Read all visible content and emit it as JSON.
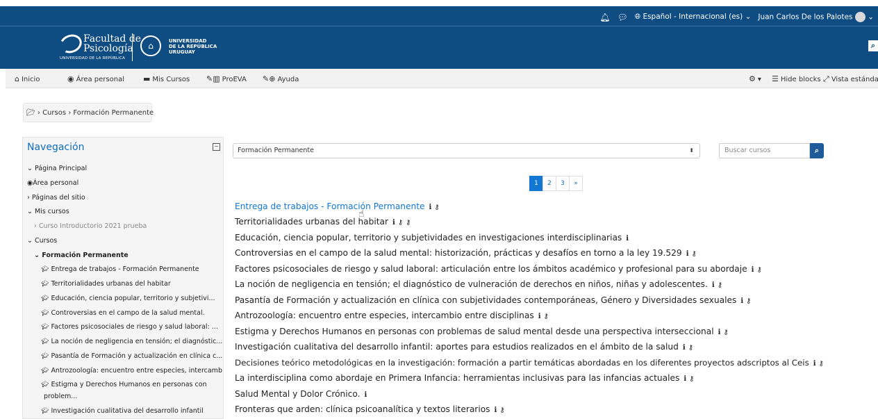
{
  "topbar": {
    "bell_icon": "bell-icon",
    "chat_icon": "chat-icon",
    "language": "Español - Internacional (es)",
    "user_name": "Juan Carlos De los Palotes"
  },
  "header": {
    "faculty_line1": "Facultad de",
    "faculty_line2": "Psicología",
    "faculty_sub": "UNIVERSIDAD DE LA REPÚBLICA",
    "univ_line1": "UNIVERSIDAD",
    "univ_line2": "DE LA REPÚBLICA",
    "univ_line3": "URUGUAY"
  },
  "navbar": {
    "inicio": "Inicio",
    "area_personal": "Área personal",
    "mis_cursos": "Mis Cursos",
    "proeva": "ProEVA",
    "ayuda": "Ayuda",
    "hide_blocks": "Hide blocks",
    "vista_estandar": "Vista estándar"
  },
  "breadcrumb": {
    "items": [
      "Cursos",
      "Formación Permanente"
    ]
  },
  "navigation_block": {
    "title": "Navegación",
    "items": [
      "Página Principal",
      "Área personal",
      "Páginas del sitio",
      "Mis cursos",
      "Curso Introductorio 2021 prueba",
      "Cursos",
      "Formación Permanente",
      "Entrega de trabajos - Formación Permanente",
      "Territorialidades urbanas del habitar",
      "Educación, ciencia popular, territorio y subjetivi...",
      "Controversias en el campo de la salud mental.",
      "Factores psicosociales de riesgo y salud laboral: ...",
      "La noción de negligencia en tensión; el diagnóstic...",
      "Pasantía de Formación y actualización en clínica c...",
      "Antrozoología: encuentro entre especies, intercamb...",
      "Estigma y Derechos Humanos en personas con",
      "problem...",
      "Investigación cualitativa del desarrollo infantil"
    ]
  },
  "category_select": {
    "value": "Formación Permanente"
  },
  "search": {
    "placeholder": "Buscar cursos"
  },
  "pagination": {
    "pages": [
      "1",
      "2",
      "3",
      "»"
    ],
    "active": "1"
  },
  "courses": [
    "Entrega de trabajos - Formación Permanente",
    "Territorialidades urbanas del habitar",
    "Educación, ciencia popular, territorio y subjetividades en investigaciones interdisciplinarias",
    "Controversias en el campo de la salud mental: historización, prácticas y desafíos en torno a la ley 19.529",
    "Factores psicosociales de riesgo y salud laboral: articulación entre los ámbitos académico y profesional para su abordaje",
    "La noción de negligencia en tensión; el diagnóstico de vulneración de derechos en niños, niñas y adolescentes.",
    "Pasantía de Formación y actualización en clínica con subjetividades contemporáneas, Género y Diversidades sexuales",
    "Antrozoología: encuentro entre especies, intercambio entre disciplinas",
    "Estigma y Derechos Humanos en personas con problemas de salud mental desde una perspectiva interseccional",
    "Investigación cualitativa del desarrollo infantil: aportes para estudios realizados en el ámbito de la salud",
    "Decisiones teórico metodológicas en la investigación: formación a partir temáticas abordadas en los diferentes proyectos adscriptos al Ceis",
    "La interdisciplina como abordaje en Primera Infancia: herramientas inclusivas para las infancias actuales",
    "Salud Mental y Dolor Crónico.",
    "Fronteras que arden: clínica psicoanalítica y textos literarios"
  ],
  "colors": {
    "brand": "#0f4c81",
    "link": "#1177d1",
    "button": "#1d5c98"
  }
}
